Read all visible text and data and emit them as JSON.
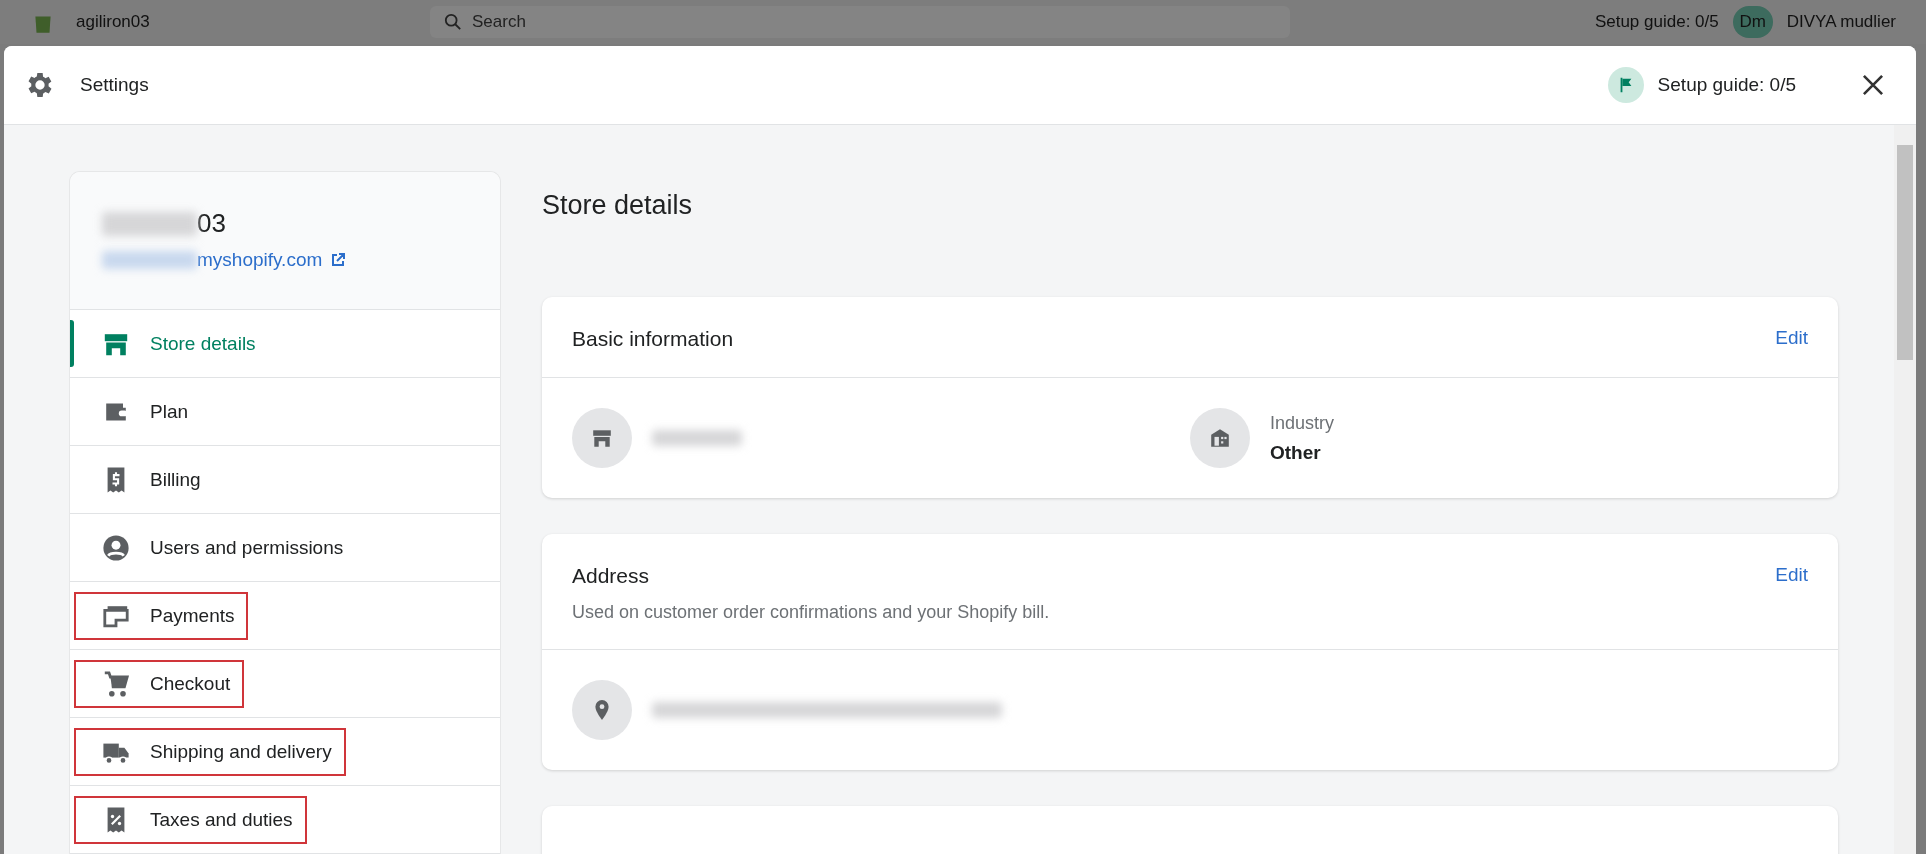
{
  "backdrop": {
    "store_name": "agiliron03",
    "search": {
      "placeholder": "Search"
    },
    "setup_guide": "Setup guide: 0/5",
    "avatar_initials": "Dm",
    "user_name": "DIVYA mudlier"
  },
  "window": {
    "title": "Settings",
    "setup_guide": "Setup guide: 0/5"
  },
  "sidebar": {
    "store_name": "03",
    "store_url": "myshopify.com",
    "items": [
      {
        "label": "Store details",
        "kind": "store",
        "selected": true,
        "annotated": false
      },
      {
        "label": "Plan",
        "kind": "wallet",
        "selected": false,
        "annotated": false
      },
      {
        "label": "Billing",
        "kind": "billing",
        "selected": false,
        "annotated": false
      },
      {
        "label": "Users and permissions",
        "kind": "users",
        "selected": false,
        "annotated": false
      },
      {
        "label": "Payments",
        "kind": "payments",
        "selected": false,
        "annotated": true
      },
      {
        "label": "Checkout",
        "kind": "checkout",
        "selected": false,
        "annotated": true
      },
      {
        "label": "Shipping and delivery",
        "kind": "shipping",
        "selected": false,
        "annotated": true
      },
      {
        "label": "Taxes and duties",
        "kind": "taxes",
        "selected": false,
        "annotated": true
      }
    ]
  },
  "page": {
    "title": "Store details",
    "basic_info": {
      "title": "Basic information",
      "action": "Edit",
      "industry_label": "Industry",
      "industry_value": "Other"
    },
    "address": {
      "title": "Address",
      "action": "Edit",
      "description": "Used on customer order confirmations and your Shopify bill."
    }
  }
}
